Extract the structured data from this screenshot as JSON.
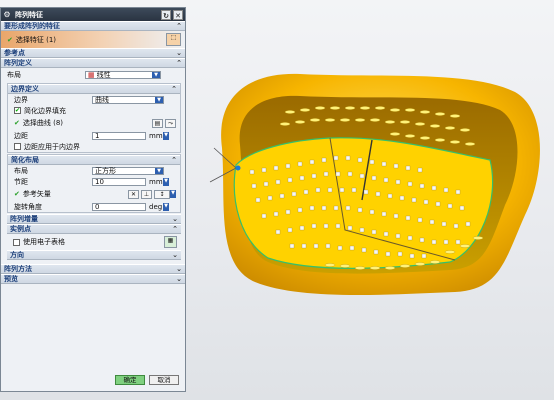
{
  "dialog": {
    "title": "阵列特征",
    "sec_features": "要形成阵列的特征",
    "select_feature": "选择特征 (1)",
    "sec_ref_point": "参考点",
    "sec_array_def": "阵列定义",
    "layout_label": "布局",
    "layout_value": "线性",
    "sec_boundary": "边界定义",
    "boundary_label": "边界",
    "boundary_value": "曲线",
    "simplify_fill": "简化边界填充",
    "select_curve": "选择曲线 (8)",
    "margin_label": "边距",
    "margin_value": "1",
    "margin_unit": "mm",
    "margin_inner": "边距应用于内边界",
    "sec_simplified": "简化布局",
    "layout2_label": "布局",
    "layout2_value": "正方形",
    "pitch_label": "节距",
    "pitch_value": "10",
    "pitch_unit": "mm",
    "ref_vector": "参考矢量",
    "rotation_label": "旋转角度",
    "rotation_value": "0",
    "rotation_unit": "deg",
    "sec_increment": "阵列增量",
    "sec_instance": "实例点",
    "use_spreadsheet": "使用电子表格",
    "sec_direction": "方向",
    "sec_method": "阵列方法",
    "sec_preview": "预览",
    "ok": "确定",
    "cancel": "取消"
  },
  "colors": {
    "accent": "#1c3f7a",
    "part": "#f5b800",
    "ok": "#7fd07f"
  }
}
